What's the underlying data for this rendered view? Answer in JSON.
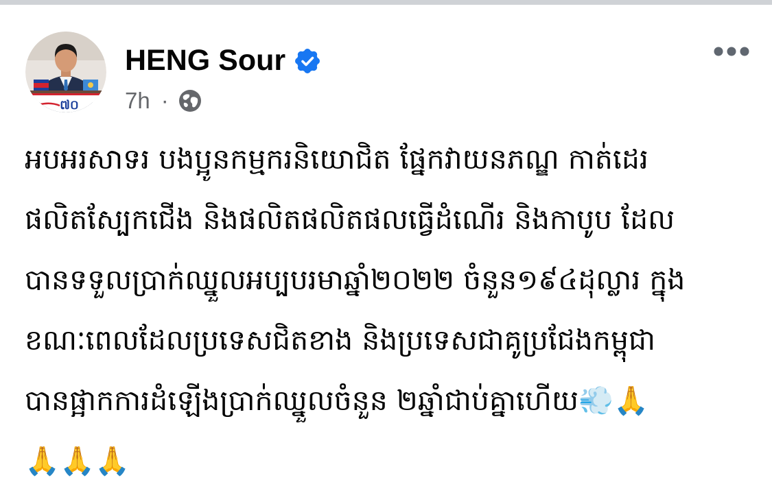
{
  "post": {
    "author": {
      "name": "HENG Sour",
      "verified": true,
      "verified_icon": "verified-badge-icon",
      "avatar_logo_text": "៧០"
    },
    "meta": {
      "time": "7h",
      "separator": "·",
      "audience_icon": "globe-icon"
    },
    "more_icon": "more-options-icon",
    "body_lines": [
      "អបអរសាទរ បងប្អូនកម្មករនិយោជិត ផ្នែកវាយនភណ្ឌ កាត់ដេរ",
      "ផលិតស្បែកជើង និងផលិតផលិតផលធ្វើដំណើរ និងកាបូប ដែល",
      "បានទទួលប្រាក់ឈ្នួលអប្បបរមាឆ្នាំ២០២២ ចំនួន១៩៤ដុល្លារ ក្នុង",
      "ខណៈពេលដែលប្រទេសជិតខាង និងប្រទេសជាគូប្រជែងកម្ពុជា",
      "បានផ្អាកការដំឡើងប្រាក់ឈ្នួលចំនួន ២ឆ្នាំជាប់គ្នាហើយ💨🙏",
      "🙏🙏🙏"
    ]
  },
  "colors": {
    "background": "#ffffff",
    "text": "#050505",
    "secondary_text": "#65676b",
    "verified_blue": "#1877f2",
    "top_bar": "#cfd2d6"
  }
}
